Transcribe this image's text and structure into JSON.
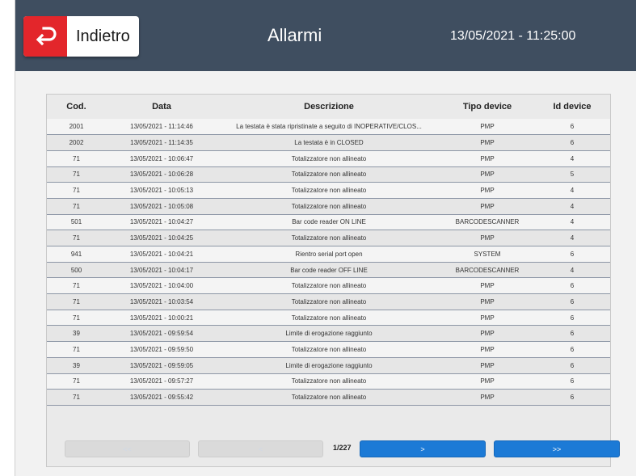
{
  "header": {
    "back_label": "Indietro",
    "title": "Allarmi",
    "datetime": "13/05/2021 - 11:25:00"
  },
  "colors": {
    "header_bg": "#3f4e60",
    "back_icon_bg": "#e3262b",
    "pager_active": "#1c7ad6"
  },
  "table": {
    "columns": [
      "Cod.",
      "Data",
      "Descrizione",
      "Tipo device",
      "Id device"
    ],
    "rows": [
      [
        "2001",
        "13/05/2021 - 11:14:46",
        "La testata è stata ripristinate a seguito di INOPERATIVE/CLOS...",
        "PMP",
        "6"
      ],
      [
        "2002",
        "13/05/2021 - 11:14:35",
        "La testata è in CLOSED",
        "PMP",
        "6"
      ],
      [
        "71",
        "13/05/2021 - 10:06:47",
        "Totalizzatore non allineato",
        "PMP",
        "4"
      ],
      [
        "71",
        "13/05/2021 - 10:06:28",
        "Totalizzatore non allineato",
        "PMP",
        "5"
      ],
      [
        "71",
        "13/05/2021 - 10:05:13",
        "Totalizzatore non allineato",
        "PMP",
        "4"
      ],
      [
        "71",
        "13/05/2021 - 10:05:08",
        "Totalizzatore non allineato",
        "PMP",
        "4"
      ],
      [
        "501",
        "13/05/2021 - 10:04:27",
        "Bar code reader ON LINE",
        "BARCODESCANNER",
        "4"
      ],
      [
        "71",
        "13/05/2021 - 10:04:25",
        "Totalizzatore non allineato",
        "PMP",
        "4"
      ],
      [
        "941",
        "13/05/2021 - 10:04:21",
        "Rientro serial port open",
        "SYSTEM",
        "6"
      ],
      [
        "500",
        "13/05/2021 - 10:04:17",
        "Bar code reader OFF LINE",
        "BARCODESCANNER",
        "4"
      ],
      [
        "71",
        "13/05/2021 - 10:04:00",
        "Totalizzatore non allineato",
        "PMP",
        "6"
      ],
      [
        "71",
        "13/05/2021 - 10:03:54",
        "Totalizzatore non allineato",
        "PMP",
        "6"
      ],
      [
        "71",
        "13/05/2021 - 10:00:21",
        "Totalizzatore non allineato",
        "PMP",
        "6"
      ],
      [
        "39",
        "13/05/2021 - 09:59:54",
        "Limite di erogazione raggiunto",
        "PMP",
        "6"
      ],
      [
        "71",
        "13/05/2021 - 09:59:50",
        "Totalizzatore non allineato",
        "PMP",
        "6"
      ],
      [
        "39",
        "13/05/2021 - 09:59:05",
        "Limite di erogazione raggiunto",
        "PMP",
        "6"
      ],
      [
        "71",
        "13/05/2021 - 09:57:27",
        "Totalizzatore non allineato",
        "PMP",
        "6"
      ],
      [
        "71",
        "13/05/2021 - 09:55:42",
        "Totalizzatore non allineato",
        "PMP",
        "6"
      ]
    ]
  },
  "pager": {
    "first_label": "<<",
    "prev_label": "<",
    "page_indicator": "1/227",
    "next_label": ">",
    "last_label": ">>"
  }
}
